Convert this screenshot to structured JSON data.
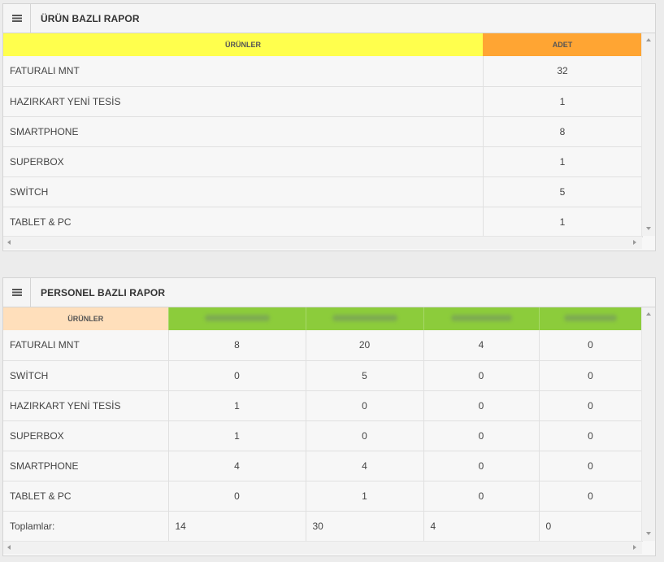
{
  "panel1": {
    "title": "ÜRÜN BAZLI RAPOR",
    "col_products": "ÜRÜNLER",
    "col_count": "ADET",
    "rows": [
      {
        "name": "FATURALI MNT",
        "count": "32"
      },
      {
        "name": "HAZIRKART YENİ TESİS",
        "count": "1"
      },
      {
        "name": "SMARTPHONE",
        "count": "8"
      },
      {
        "name": "SUPERBOX",
        "count": "1"
      },
      {
        "name": "SWİTCH",
        "count": "5"
      },
      {
        "name": "TABLET & PC",
        "count": "1"
      }
    ],
    "colors": {
      "products_header": "#ffff4d",
      "count_header": "#ffa533"
    }
  },
  "panel2": {
    "title": "PERSONEL BAZLI RAPOR",
    "col_products": "ÜRÜNLER",
    "rows": [
      {
        "name": "FATURALI MNT",
        "v": [
          "8",
          "20",
          "4",
          "0"
        ]
      },
      {
        "name": "SWİTCH",
        "v": [
          "0",
          "5",
          "0",
          "0"
        ]
      },
      {
        "name": "HAZIRKART YENİ TESİS",
        "v": [
          "1",
          "0",
          "0",
          "0"
        ]
      },
      {
        "name": "SUPERBOX",
        "v": [
          "1",
          "0",
          "0",
          "0"
        ]
      },
      {
        "name": "SMARTPHONE",
        "v": [
          "4",
          "4",
          "0",
          "0"
        ]
      },
      {
        "name": "TABLET & PC",
        "v": [
          "0",
          "1",
          "0",
          "0"
        ]
      }
    ],
    "totals_label": "Toplamlar:",
    "totals": [
      "14",
      "30",
      "4",
      "0"
    ],
    "colors": {
      "products_header": "#ffdfbb",
      "staff_header": "#8ccc3b"
    }
  }
}
